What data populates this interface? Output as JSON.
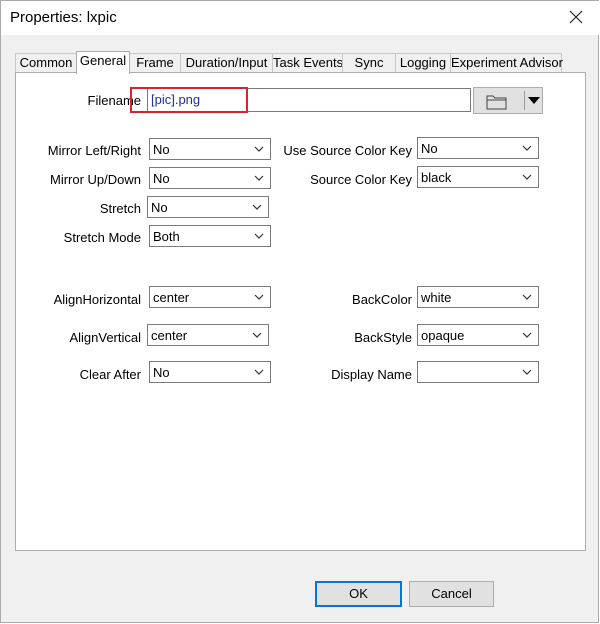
{
  "window": {
    "title": "Properties: lxpic"
  },
  "tabs": [
    "Common",
    "General",
    "Frame",
    "Duration/Input",
    "Task Events",
    "Sync",
    "Logging",
    "Experiment Advisor"
  ],
  "active_tab": "General",
  "filename": {
    "label": "Filename",
    "value": "[pic].png"
  },
  "fields": {
    "mirror_lr": {
      "label": "Mirror Left/Right",
      "value": "No"
    },
    "mirror_ud": {
      "label": "Mirror Up/Down",
      "value": "No"
    },
    "stretch": {
      "label": "Stretch",
      "value": "No"
    },
    "stretch_mode": {
      "label": "Stretch Mode",
      "value": "Both"
    },
    "use_source_color_key": {
      "label": "Use Source Color Key",
      "value": "No"
    },
    "source_color_key": {
      "label": "Source Color Key",
      "value": "black"
    },
    "align_horizontal": {
      "label": "AlignHorizontal",
      "value": "center"
    },
    "align_vertical": {
      "label": "AlignVertical",
      "value": "center"
    },
    "clear_after": {
      "label": "Clear After",
      "value": "No"
    },
    "back_color": {
      "label": "BackColor",
      "value": "white"
    },
    "back_style": {
      "label": "BackStyle",
      "value": "opaque"
    },
    "display_name": {
      "label": "Display Name",
      "value": ""
    }
  },
  "buttons": {
    "ok": "OK",
    "cancel": "Cancel"
  },
  "icons": {
    "close": "close-icon",
    "folder": "folder-icon",
    "dropdown": "chevron-down-icon"
  },
  "colors": {
    "highlight": "#d8242a",
    "filename_text": "#1f2d9f",
    "default_button_border": "#0078d7"
  }
}
